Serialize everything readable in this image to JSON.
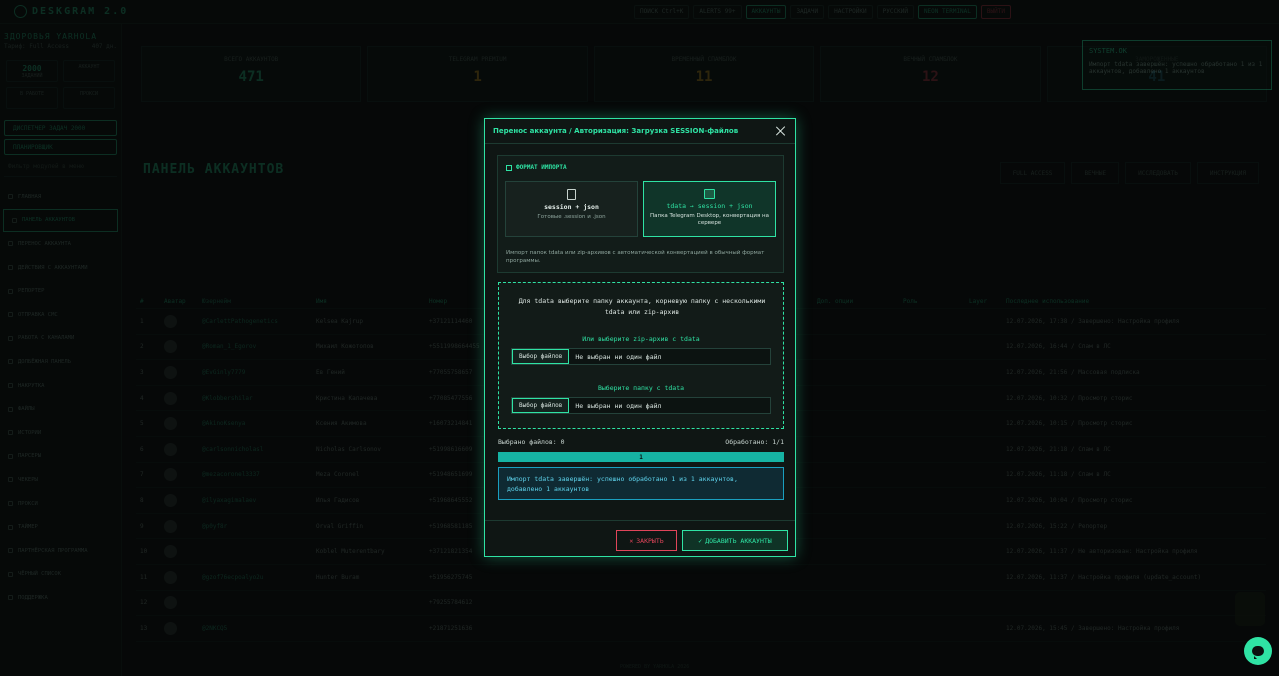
{
  "app": {
    "brand": "DESKGRAM 2.0",
    "top": {
      "search": "ПОИСК",
      "search_kbd": "Ctrl+K",
      "alerts": "ALERTS",
      "alerts_count": "99+",
      "accounts": "АККАУНТЫ",
      "tasks": "ЗАДАЧИ",
      "settings": "НАСТРОЙКИ",
      "lang": "РУССКИЙ",
      "theme": "NEON TERMINAL",
      "exit": "ВЫЙТИ"
    },
    "sidebar": {
      "user": "ЗДОРОВЬЯ YARHOLA",
      "role": "Тариф: Full Access",
      "days": "407 дн.",
      "tiles": [
        {
          "value": "2000",
          "label": "ЗАДАНИЙ"
        },
        {
          "value": "",
          "label": "АККАУНТ"
        },
        {
          "value": "",
          "label": "В РАБОТЕ"
        },
        {
          "value": "",
          "label": "ПРОКСИ"
        }
      ],
      "dispatcher": "ДИСПЕТЧЕР ЗАДАЧ",
      "dispatcher_badge": "2000",
      "planner": "ПЛАНИРОВЩИК",
      "search_placeholder": "Фильтр модулей в меню",
      "items": [
        "ГЛАВНАЯ",
        "ПАНЕЛЬ АККАУНТОВ",
        "ПЕРЕНОС АККАУНТА",
        "ДЕЙСТВИЯ С АККАУНТАМИ",
        "РЕПОРТЕР",
        "ОТПРАВКА СМС",
        "РАБОТА С КАНАЛАМИ",
        "ДОЛБЁЖНАЯ ПАНЕЛЬ",
        "НАКРУТКА",
        "ФАЙЛЫ",
        "ИСТОРИИ",
        "ПАРСЕРЫ",
        "ЧЕКЕРЫ",
        "ПРОКСИ",
        "ТАЙМЕР",
        "ПАРТНЁРСКАЯ ПРОГРАММА",
        "ЧЁРНЫЙ СПИСОК",
        "ПОДДЕРЖКА"
      ]
    },
    "stats": [
      {
        "label": "ВСЕГО АККАУНТОВ",
        "value": "471",
        "color": "#2fe3a4"
      },
      {
        "label": "TELEGRAM PREMIUM",
        "value": "1",
        "color": "#f0b429"
      },
      {
        "label": "ВРЕМЕННЫЙ СПАМБЛОК",
        "value": "11",
        "color": "#f0b429"
      },
      {
        "label": "ВЕЧНЫЙ СПАМБЛОК",
        "value": "12",
        "color": "#e0455a"
      },
      {
        "label": "ЗАМОРОЖЕННЫЕ",
        "value": "41",
        "color": "#38c6f4"
      }
    ],
    "toast": {
      "title": "SYSTEM.OK",
      "text": "Импорт tdata завершён: успешно обработано 1 из 1 аккаунтов, добавлено 1 аккаунтов"
    },
    "panel_title": "ПАНЕЛЬ АККАУНТОВ",
    "right_buttons": [
      "FULL ACCESS",
      "ВЕЧНЫЕ",
      "ИССЛЕДОВАТЬ",
      "ИНСТРУКЦИЯ"
    ],
    "columns": [
      "#",
      "Аватар",
      "Юзернейм",
      "Имя",
      "Номер",
      "",
      "Доп. опции",
      "Роль",
      "Layer",
      "Последнее использование"
    ],
    "rows": [
      {
        "n": "1",
        "user": "@CarlettPathogenetics",
        "name": "Kelsea Kajrup",
        "phone": "+37121114460",
        "date": "12.07.2026, 17:38 / Завершено: Настройка профиля"
      },
      {
        "n": "2",
        "user": "@Roman_1_Egorov",
        "name": "Михаил Кожотопов",
        "phone": "+5511998664455",
        "date": "12.07.2026, 16:44 / Спам в ЛС"
      },
      {
        "n": "3",
        "user": "@EvGinly7779",
        "name": "Ев Гений",
        "phone": "+77055758657",
        "date": "12.07.2026, 21:56 / Массовая подписка"
      },
      {
        "n": "4",
        "user": "@Klobbershilar",
        "name": "Кристина Калачева",
        "phone": "+77085477556",
        "date": "12.07.2026, 10:32 / Просмотр сторис"
      },
      {
        "n": "5",
        "user": "@AkinoKsenya",
        "name": "Ксения Акимова",
        "phone": "+16073214841",
        "date": "12.07.2026, 10:15 / Просмотр сторис"
      },
      {
        "n": "6",
        "user": "@carlsonnicholasl",
        "name": "Nicholas Carlsonov",
        "phone": "+51998616609",
        "date": "12.07.2026, 21:18 / Спам в ЛС"
      },
      {
        "n": "7",
        "user": "@mezacoronel3337",
        "name": "Meza Coronel",
        "phone": "+51948651699",
        "date": "12.07.2026, 11:18 / Спам в ЛС"
      },
      {
        "n": "8",
        "user": "@ilyaxagimalaev",
        "name": "Илья Гадисов",
        "phone": "+51968645552",
        "date": "12.07.2026, 10:04 / Просмотр сторис"
      },
      {
        "n": "9",
        "user": "@p0yf8r",
        "name": "Orval Griffin",
        "phone": "+51968581185",
        "date": "12.07.2026, 15:22 / Репортер"
      },
      {
        "n": "10",
        "user": "",
        "name": "Koblel Muterentbary",
        "phone": "+37121821354",
        "date": "12.07.2026, 11:37 / Не авторизован: Настройка профиля"
      },
      {
        "n": "11",
        "user": "@gzof76ecpoalyo2u",
        "name": "Hunter Buram",
        "phone": "+51956275745",
        "date": "12.07.2026, 11:37 / Настройка профиля (update_account)"
      },
      {
        "n": "12",
        "user": "",
        "name": "",
        "phone": "+79255784612",
        "date": ""
      },
      {
        "n": "13",
        "user": "@2NKCQ5",
        "name": "",
        "phone": "+21871251636",
        "date": "12.07.2026, 15:45 / Завершено: Настройка профиля"
      }
    ],
    "footer": "POWERED BY YARHOLA 2026"
  },
  "modal": {
    "title": "Перенос аккаунта / Авторизация: Загрузка SESSION-файлов",
    "format_title": "ФОРМАТ ИМПОРТА",
    "options": [
      {
        "name": "session + json",
        "desc": "Готовые .session и .json"
      },
      {
        "name": "tdata → session + json",
        "desc": "Папка Telegram Desktop, конвертация на сервере"
      }
    ],
    "format_note": "Импорт папок tdata или zip-архивов с автоматической конвертацией в обычный формат программы.",
    "drop_text": "Для tdata выберите папку аккаунта, корневую папку с несколькими tdata или zip-архив",
    "zip_label": "Или выберите zip-архив с tdata",
    "folder_label": "Выберите папку с tdata",
    "file_button": "Выбор файлов",
    "no_file": "Не выбран ни один файл",
    "selected": "Выбрано файлов: 0",
    "processed": "Обработано: 1/1",
    "progress": 1,
    "progress_label": "1",
    "message": "Импорт tdata завершён: успешно обработано 1 из 1 аккаунтов, добавлено 1 аккаунтов",
    "close_label": "ЗАКРЫТЬ",
    "add_label": "ДОБАВИТЬ АККАУНТЫ"
  },
  "colors": {
    "accent": "#2fe3a4",
    "danger": "#e0455a",
    "info": "#1a9fbf"
  },
  "icons": [
    "logo-icon",
    "search-icon",
    "bell-icon",
    "close-icon",
    "file-icon",
    "folder-icon",
    "chat-icon"
  ]
}
